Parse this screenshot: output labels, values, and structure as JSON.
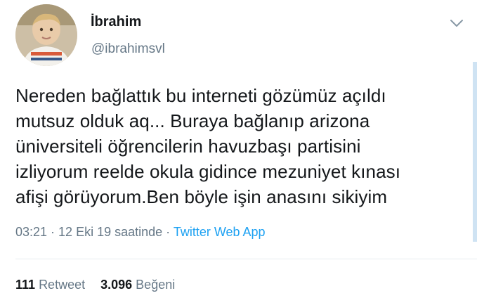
{
  "author": {
    "display_name": "İbrahim",
    "handle": "@ibrahimsvl"
  },
  "tweet": {
    "lines": [
      "Nereden bağlattık bu interneti gözümüz açıldı",
      "mutsuz olduk aq... Buraya bağlanıp arizona",
      "üniversiteli öğrencilerin havuzbaşı partisini",
      "izliyorum reelde okula gidince mezuniyet kınası",
      "afişi görüyorum.Ben böyle işin anasını sikiyim"
    ],
    "time": "03:21",
    "separator": " · ",
    "date": "12 Eki 19 saatinde",
    "source": "Twitter Web App"
  },
  "stats": {
    "retweet_count": "111",
    "retweet_label": "Retweet",
    "like_count": "3.096",
    "like_label": "Beğeni"
  },
  "icons": {
    "caret": "chevron-down-icon"
  },
  "colors": {
    "text": "#14171a",
    "secondary": "#657786",
    "link": "#1da1f2",
    "divider": "#e6ecf0"
  }
}
